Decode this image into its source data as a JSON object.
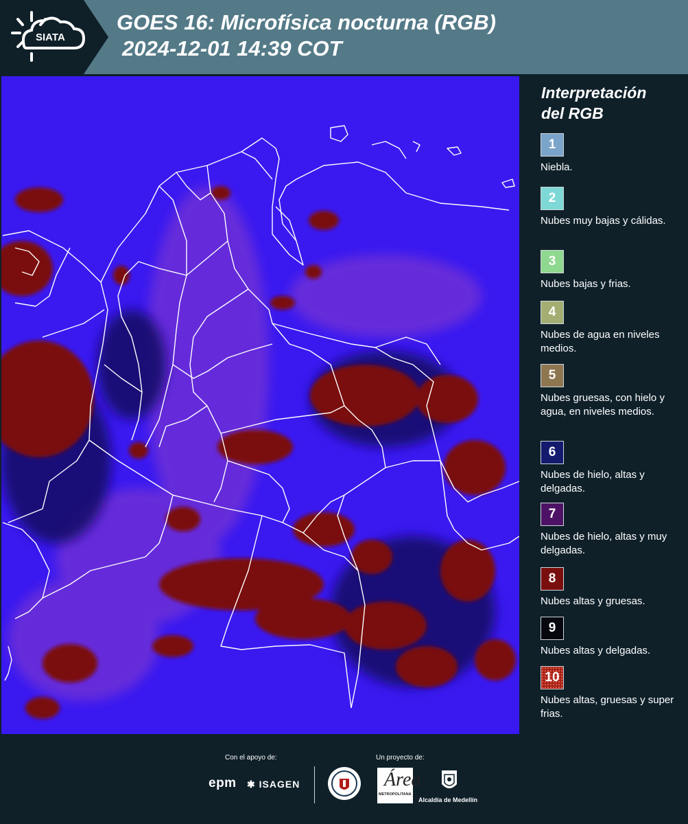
{
  "header": {
    "logo_text": "SIATA",
    "title_line1": "GOES 16: Microfísica nocturna (RGB)",
    "title_line2": "2024-12-01 14:39 COT",
    "background_color": "#547a88"
  },
  "legend": {
    "title_line1": "Interpretación",
    "title_line2": "del RGB",
    "items": [
      {
        "number": "1",
        "color": "#7aa4c9",
        "text": "Niebla."
      },
      {
        "number": "2",
        "color": "#7dd8d6",
        "text": "Nubes muy bajas y cálidas."
      },
      {
        "number": "3",
        "color": "#8fd88f",
        "text": "Nubes bajas y frias."
      },
      {
        "number": "4",
        "color": "#a4ae73",
        "text": "Nubes de agua en niveles medios."
      },
      {
        "number": "5",
        "color": "#8e7650",
        "text": "Nubes gruesas, con hielo y agua, en niveles medios."
      },
      {
        "number": "6",
        "color": "#141a6e",
        "text": "Nubes de hielo, altas y delgadas."
      },
      {
        "number": "7",
        "color": "#4d1265",
        "text": "Nubes de hielo, altas y muy delgadas."
      },
      {
        "number": "8",
        "color": "#7a0e0e",
        "text": "Nubes altas y gruesas."
      },
      {
        "number": "9",
        "color": "#05070d",
        "text": "Nubes altas y delgadas."
      },
      {
        "number": "10",
        "color": "#a52218",
        "text": "Nubes altas, gruesas y super frias."
      }
    ]
  },
  "map": {
    "base_color": "#3a19f0",
    "cloud_color": "#7a0e0e",
    "border_color": "#ffffff"
  },
  "footer": {
    "support_label": "Con el apoyo de:",
    "project_label": "Un proyecto de:",
    "sponsor1": "epm",
    "sponsor2": "ISAGEN",
    "partner1_initial": "Área",
    "partner1_text": "METROPOLITANA",
    "partner2": "Alcaldía de Medellín"
  }
}
